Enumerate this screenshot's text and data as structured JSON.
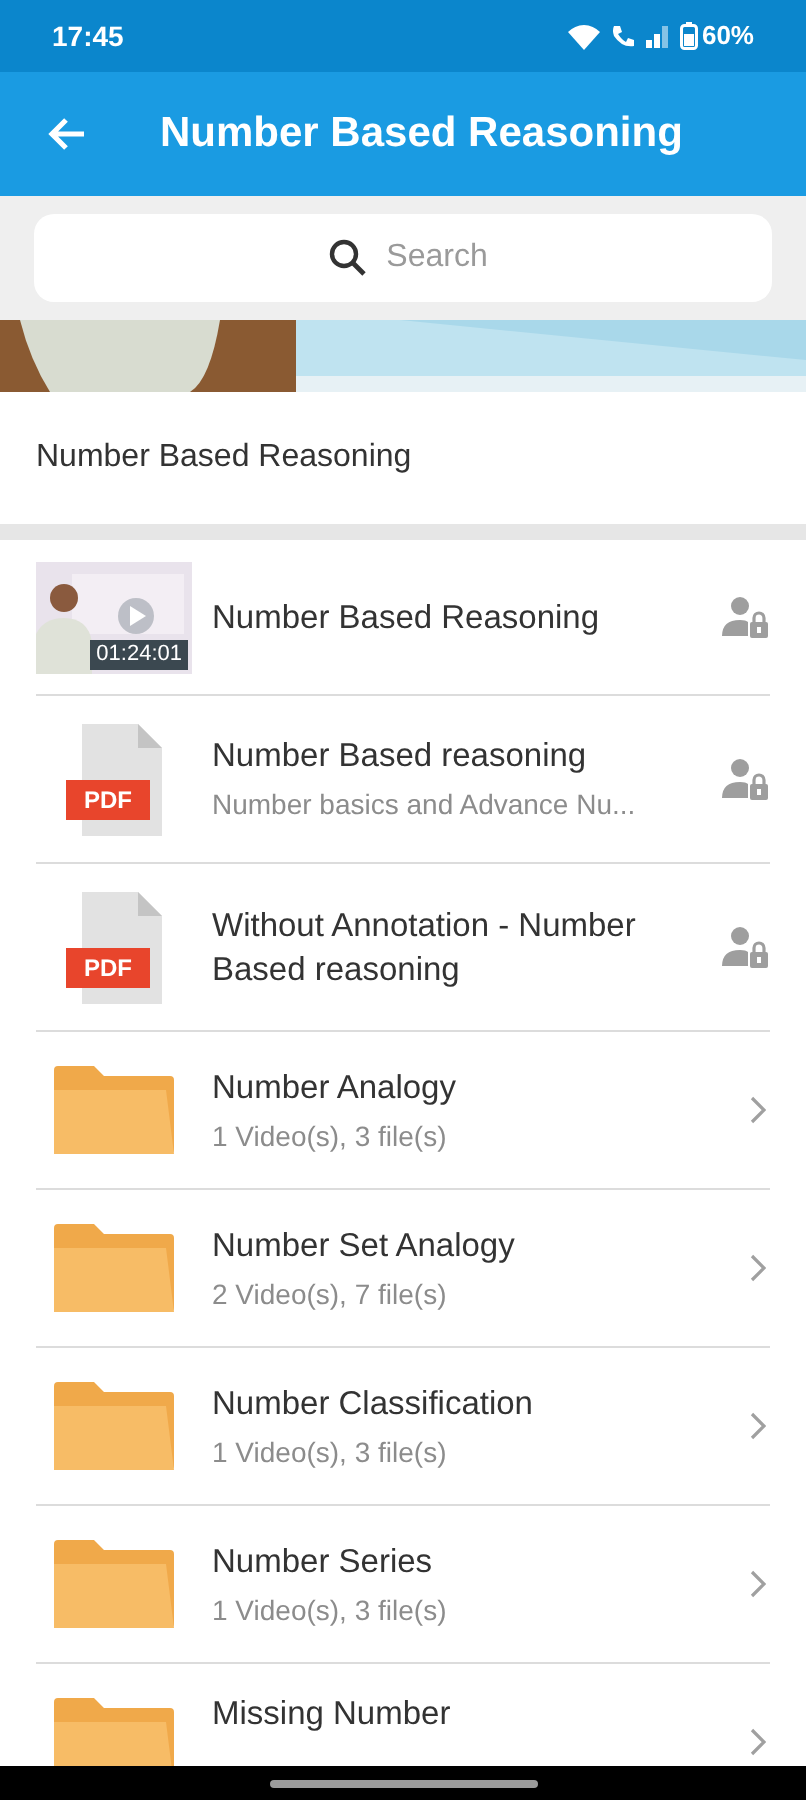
{
  "status_bar": {
    "time": "17:45",
    "battery": "60%"
  },
  "app_bar": {
    "title": "Number Based Reasoning"
  },
  "search": {
    "placeholder": "Search"
  },
  "section": {
    "title": "Number Based Reasoning"
  },
  "items": [
    {
      "kind": "video",
      "title": "Number Based Reasoning",
      "duration": "01:24:01"
    },
    {
      "kind": "pdf",
      "badge": "PDF",
      "title": "Number Based reasoning",
      "subtitle": "Number basics and Advance Nu..."
    },
    {
      "kind": "pdf",
      "badge": "PDF",
      "title": "Without Annotation - Number Based reasoning"
    },
    {
      "kind": "folder",
      "title": "Number Analogy",
      "subtitle": "1 Video(s), 3 file(s)"
    },
    {
      "kind": "folder",
      "title": "Number Set Analogy",
      "subtitle": "2 Video(s), 7 file(s)"
    },
    {
      "kind": "folder",
      "title": "Number Classification",
      "subtitle": "1 Video(s), 3 file(s)"
    },
    {
      "kind": "folder",
      "title": "Number Series",
      "subtitle": "1 Video(s), 3 file(s)"
    },
    {
      "kind": "folder",
      "title": "Missing Number"
    }
  ]
}
